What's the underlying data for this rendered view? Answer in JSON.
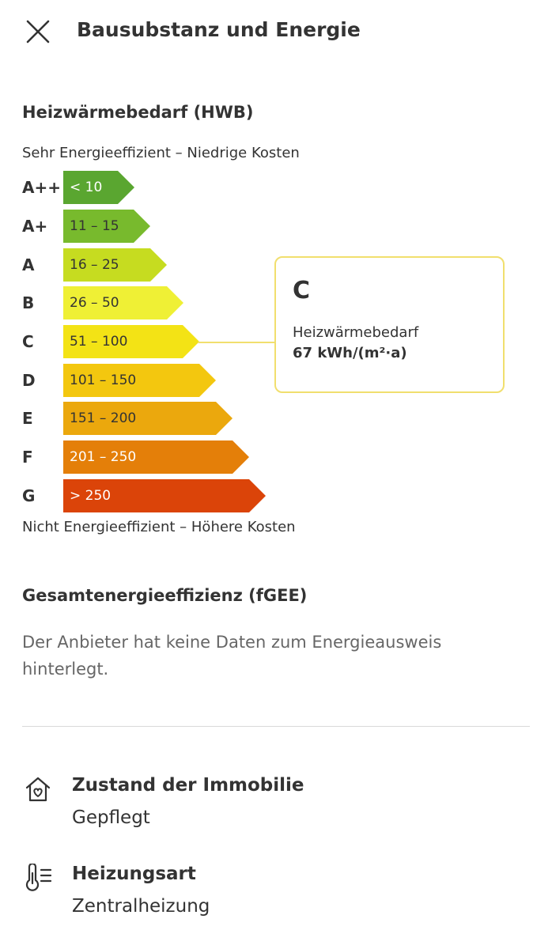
{
  "header": {
    "close_icon": "close-icon",
    "title": "Bausubstanz und Energie"
  },
  "hwb": {
    "title": "Heizwärmebedarf (HWB)",
    "top_caption": "Sehr Energieeffizient – Niedrige Kosten",
    "bottom_caption": "Nicht Energieeffizient – Höhere Kosten",
    "classes": [
      {
        "letter": "A++",
        "range": "< 10",
        "color": "#5aa630",
        "text_color": "#ffffff"
      },
      {
        "letter": "A+",
        "range": "11 – 15",
        "color": "#78ba2d",
        "text_color": "#333333"
      },
      {
        "letter": "A",
        "range": "16 – 25",
        "color": "#c6dc20",
        "text_color": "#333333"
      },
      {
        "letter": "B",
        "range": "26 – 50",
        "color": "#eff035",
        "text_color": "#333333"
      },
      {
        "letter": "C",
        "range": "51 – 100",
        "color": "#f3e315",
        "text_color": "#333333"
      },
      {
        "letter": "D",
        "range": "101 – 150",
        "color": "#f3c70f",
        "text_color": "#333333"
      },
      {
        "letter": "E",
        "range": "151 – 200",
        "color": "#eba80d",
        "text_color": "#333333"
      },
      {
        "letter": "F",
        "range": "201 – 250",
        "color": "#e47f09",
        "text_color": "#ffffff"
      },
      {
        "letter": "G",
        "range": "> 250",
        "color": "#db4409",
        "text_color": "#ffffff"
      }
    ],
    "result": {
      "class": "C",
      "label": "Heizwärmebedarf",
      "value": "67 kWh/(m²·a)",
      "border_color": "#f1df6e"
    }
  },
  "fgee": {
    "title": "Gesamtenergieeffizienz (fGEE)",
    "text": "Der Anbieter hat keine Daten zum Energieausweis hinterlegt."
  },
  "features": [
    {
      "icon": "house-heart-icon",
      "title": "Zustand der Immobilie",
      "value": "Gepflegt"
    },
    {
      "icon": "thermometer-icon",
      "title": "Heizungsart",
      "value": "Zentralheizung"
    }
  ]
}
